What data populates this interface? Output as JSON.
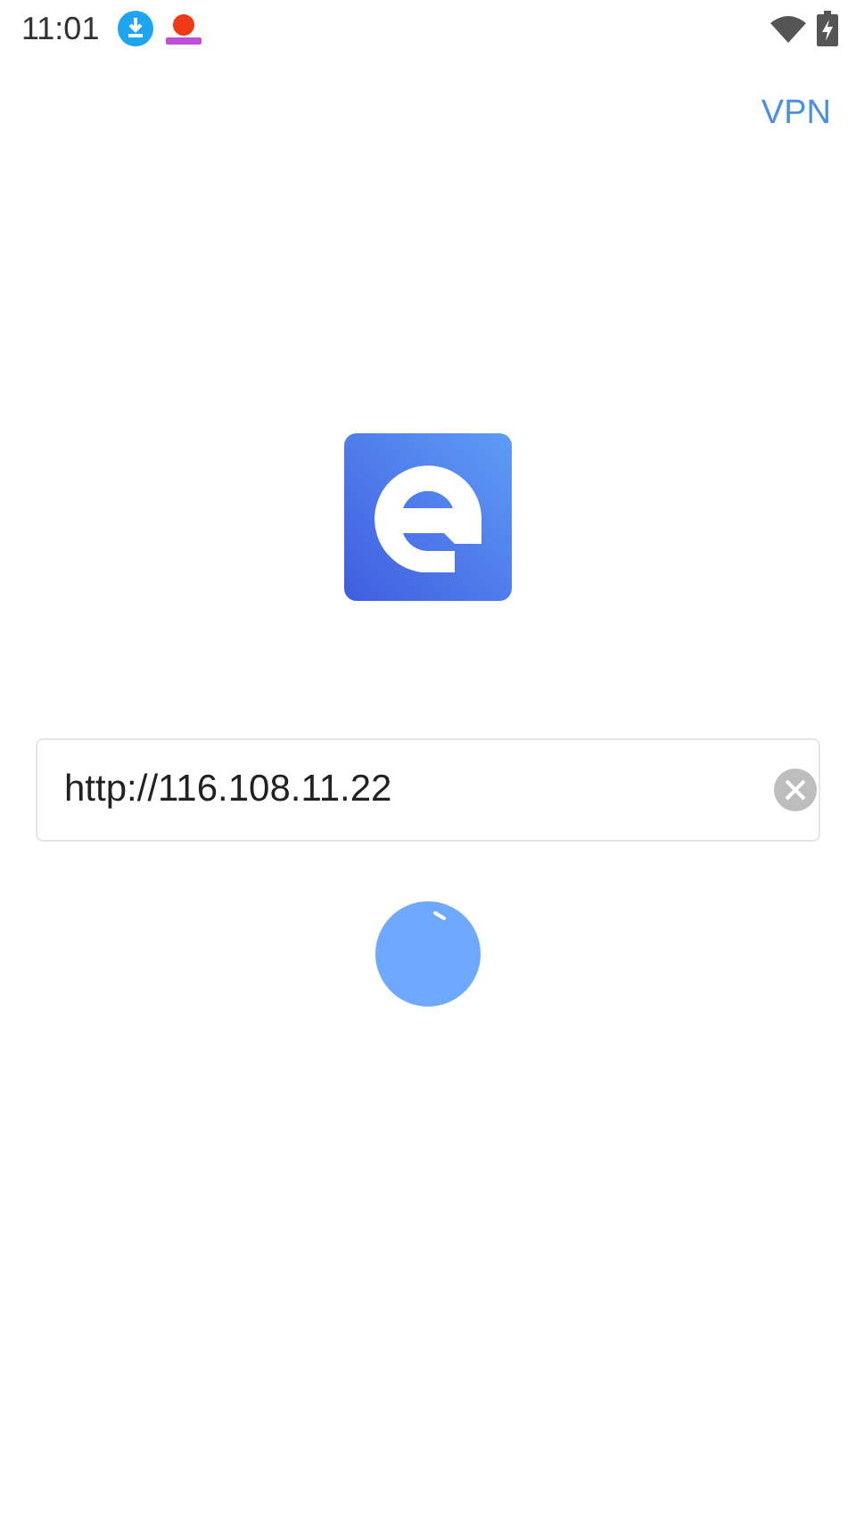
{
  "status_bar": {
    "time": "11:01"
  },
  "header": {
    "action": "VPN"
  },
  "url_field": {
    "value": "http://116.108.11.22"
  }
}
